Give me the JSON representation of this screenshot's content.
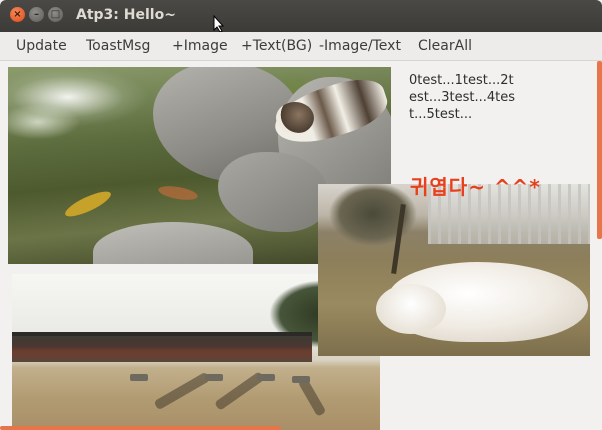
{
  "window": {
    "title": "Atp3: Hello~",
    "controls": [
      "close-icon",
      "minimize-icon",
      "maximize-icon"
    ]
  },
  "menu": {
    "items": [
      {
        "label": "Update"
      },
      {
        "label": "ToastMsg"
      },
      {
        "label": "+Image"
      },
      {
        "label": "+Text(BG)"
      },
      {
        "label": "-Image/Text"
      },
      {
        "label": "ClearAll"
      }
    ]
  },
  "content": {
    "test_text": "0test...1test...2test...3test...4test...5test...",
    "overlay_text": "귀엽다~ ^^*"
  },
  "colors": {
    "titlebar": "#3c3b37",
    "accent": "#e8754a",
    "overlay_text": "#e8401c"
  }
}
